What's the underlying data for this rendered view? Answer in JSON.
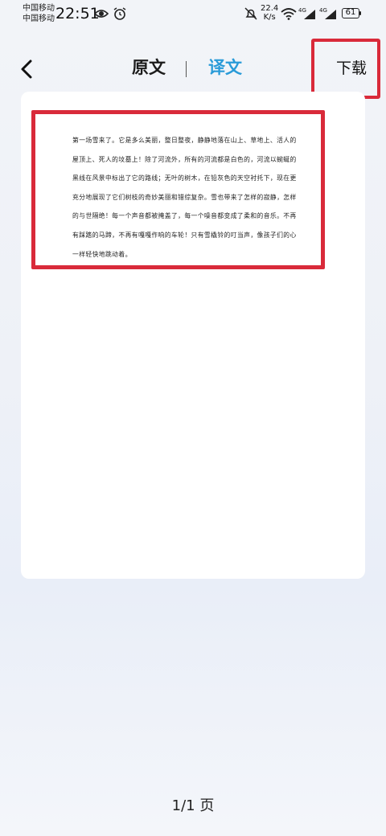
{
  "status_bar": {
    "carrier_1": "中国移动",
    "carrier_2": "中国移动",
    "time": "22:51",
    "net_speed_value": "22.4",
    "net_speed_unit": "K/s",
    "signal_1_label": "4G",
    "signal_2_label": "4G",
    "battery": "61"
  },
  "header": {
    "tab_original": "原文",
    "tab_translated": "译文",
    "download_label": "下载",
    "active_tab": "译文"
  },
  "document": {
    "text": "第一场雪来了。它是多么美丽，整日整夜，静静地落在山上、草地上、活人的屋顶上、死人的坟墓上！除了河流外，所有的河流都是白色的，河流以蜿蜒的黑线在风景中标出了它的路线；无叶的树木，在铅灰色的天空衬托下，现在更充分地展现了它们树枝的奇妙美丽和错综复杂。雪也带来了怎样的寂静，怎样的与世隔绝！每一个声音都被掩盖了，每一个噪音都变成了柔和的音乐。不再有踩踏的马蹄，不再有嘎嘎作响的车轮！只有雪橇铃的叮当声，像孩子们的心一样轻快地跳动着。"
  },
  "footer": {
    "page_indicator": "1/1 页"
  },
  "colors": {
    "accent": "#2a9bd8",
    "highlight_red": "#d92a3a"
  }
}
